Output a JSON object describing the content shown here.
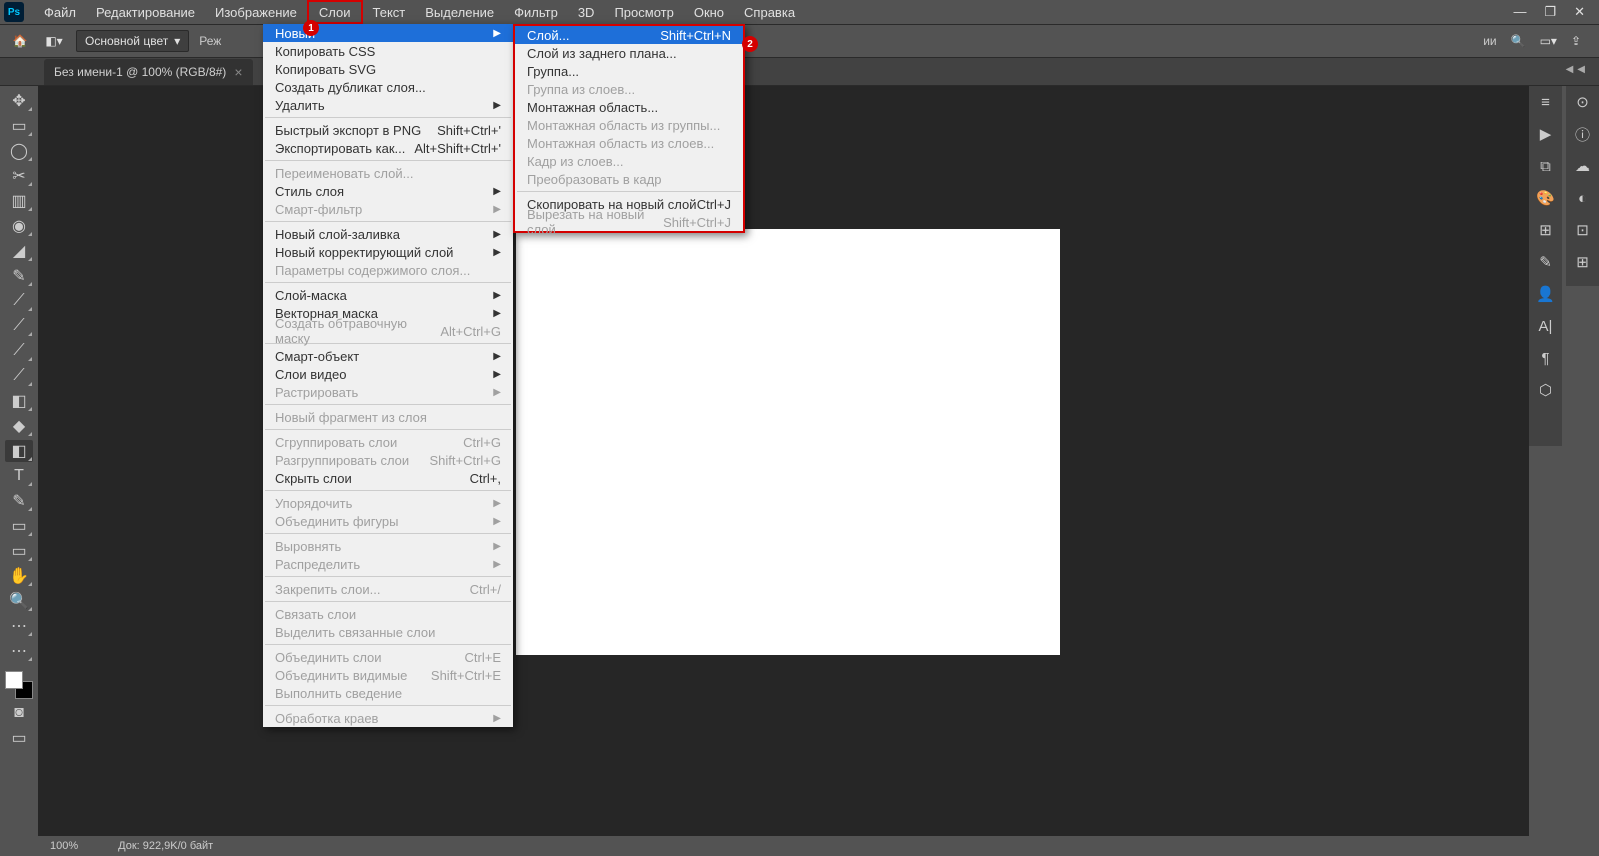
{
  "app": {
    "logo": "Ps"
  },
  "menubar": [
    "Файл",
    "Редактирование",
    "Изображение",
    "Слои",
    "Текст",
    "Выделение",
    "Фильтр",
    "3D",
    "Просмотр",
    "Окно",
    "Справка"
  ],
  "menubar_active_index": 3,
  "options": {
    "fill_mode": "Основной цвет",
    "mode_label_partial": "Реж",
    "right_trailing": "ии"
  },
  "tab": {
    "title": "Без имени-1 @ 100% (RGB/8#)"
  },
  "status": {
    "zoom": "100%",
    "doc": "Док: 922,9K/0 байт"
  },
  "badges": {
    "one": "1",
    "two": "2"
  },
  "menu_layers": [
    {
      "t": "item",
      "label": "Новый",
      "arrow": true,
      "hl": true
    },
    {
      "t": "item",
      "label": "Копировать CSS"
    },
    {
      "t": "item",
      "label": "Копировать SVG"
    },
    {
      "t": "item",
      "label": "Создать дубликат слоя..."
    },
    {
      "t": "item",
      "label": "Удалить",
      "arrow": true
    },
    {
      "t": "sep"
    },
    {
      "t": "item",
      "label": "Быстрый экспорт в PNG",
      "sc": "Shift+Ctrl+'"
    },
    {
      "t": "item",
      "label": "Экспортировать как...",
      "sc": "Alt+Shift+Ctrl+'"
    },
    {
      "t": "sep"
    },
    {
      "t": "item",
      "label": "Переименовать слой...",
      "disabled": true
    },
    {
      "t": "item",
      "label": "Стиль слоя",
      "arrow": true
    },
    {
      "t": "item",
      "label": "Смарт-фильтр",
      "arrow": true,
      "disabled": true
    },
    {
      "t": "sep"
    },
    {
      "t": "item",
      "label": "Новый слой-заливка",
      "arrow": true
    },
    {
      "t": "item",
      "label": "Новый корректирующий слой",
      "arrow": true
    },
    {
      "t": "item",
      "label": "Параметры содержимого слоя...",
      "disabled": true
    },
    {
      "t": "sep"
    },
    {
      "t": "item",
      "label": "Слой-маска",
      "arrow": true
    },
    {
      "t": "item",
      "label": "Векторная маска",
      "arrow": true
    },
    {
      "t": "item",
      "label": "Создать обтравочную маску",
      "sc": "Alt+Ctrl+G",
      "disabled": true
    },
    {
      "t": "sep"
    },
    {
      "t": "item",
      "label": "Смарт-объект",
      "arrow": true
    },
    {
      "t": "item",
      "label": "Слои видео",
      "arrow": true
    },
    {
      "t": "item",
      "label": "Растрировать",
      "arrow": true,
      "disabled": true
    },
    {
      "t": "sep"
    },
    {
      "t": "item",
      "label": "Новый фрагмент из слоя",
      "disabled": true
    },
    {
      "t": "sep"
    },
    {
      "t": "item",
      "label": "Сгруппировать слои",
      "sc": "Ctrl+G",
      "disabled": true
    },
    {
      "t": "item",
      "label": "Разгруппировать слои",
      "sc": "Shift+Ctrl+G",
      "disabled": true
    },
    {
      "t": "item",
      "label": "Скрыть слои",
      "sc": "Ctrl+,"
    },
    {
      "t": "sep"
    },
    {
      "t": "item",
      "label": "Упорядочить",
      "arrow": true,
      "disabled": true
    },
    {
      "t": "item",
      "label": "Объединить фигуры",
      "arrow": true,
      "disabled": true
    },
    {
      "t": "sep"
    },
    {
      "t": "item",
      "label": "Выровнять",
      "arrow": true,
      "disabled": true
    },
    {
      "t": "item",
      "label": "Распределить",
      "arrow": true,
      "disabled": true
    },
    {
      "t": "sep"
    },
    {
      "t": "item",
      "label": "Закрепить слои...",
      "sc": "Ctrl+/",
      "disabled": true
    },
    {
      "t": "sep"
    },
    {
      "t": "item",
      "label": "Связать слои",
      "disabled": true
    },
    {
      "t": "item",
      "label": "Выделить связанные слои",
      "disabled": true
    },
    {
      "t": "sep"
    },
    {
      "t": "item",
      "label": "Объединить слои",
      "sc": "Ctrl+E",
      "disabled": true
    },
    {
      "t": "item",
      "label": "Объединить видимые",
      "sc": "Shift+Ctrl+E",
      "disabled": true
    },
    {
      "t": "item",
      "label": "Выполнить сведение",
      "disabled": true
    },
    {
      "t": "sep"
    },
    {
      "t": "item",
      "label": "Обработка краев",
      "arrow": true,
      "disabled": true
    }
  ],
  "menu_new": [
    {
      "t": "item",
      "label": "Слой...",
      "sc": "Shift+Ctrl+N",
      "hl": true
    },
    {
      "t": "item",
      "label": "Слой из заднего плана..."
    },
    {
      "t": "item",
      "label": "Группа..."
    },
    {
      "t": "item",
      "label": "Группа из слоев...",
      "disabled": true
    },
    {
      "t": "item",
      "label": "Монтажная область..."
    },
    {
      "t": "item",
      "label": "Монтажная область из группы...",
      "disabled": true
    },
    {
      "t": "item",
      "label": "Монтажная область из слоев...",
      "disabled": true
    },
    {
      "t": "item",
      "label": "Кадр из слоев...",
      "disabled": true
    },
    {
      "t": "item",
      "label": "Преобразовать в кадр",
      "disabled": true
    },
    {
      "t": "sep"
    },
    {
      "t": "item",
      "label": "Скопировать на новый слой",
      "sc": "Ctrl+J"
    },
    {
      "t": "item",
      "label": "Вырезать на новый слой",
      "sc": "Shift+Ctrl+J",
      "disabled": true
    }
  ],
  "tools": [
    "✥",
    "▭",
    "◯",
    "✂",
    "▥",
    "◉",
    "◢",
    "✎",
    "⟋",
    "⟋",
    "⟋",
    "⟋",
    "◧",
    "◆",
    "◧",
    "T",
    "✎",
    "▭",
    "▭",
    "✋",
    "🔍",
    "⋯",
    "⋯"
  ],
  "right_icons_a": [
    "≡",
    "▶",
    "⧉",
    "🎨",
    "⊞",
    "✎",
    "👤",
    "A|",
    "¶",
    "⬡"
  ],
  "right_icons_b": [
    "⊙",
    "ⓘ",
    "☁",
    "◐",
    "⊡",
    "⊞"
  ]
}
